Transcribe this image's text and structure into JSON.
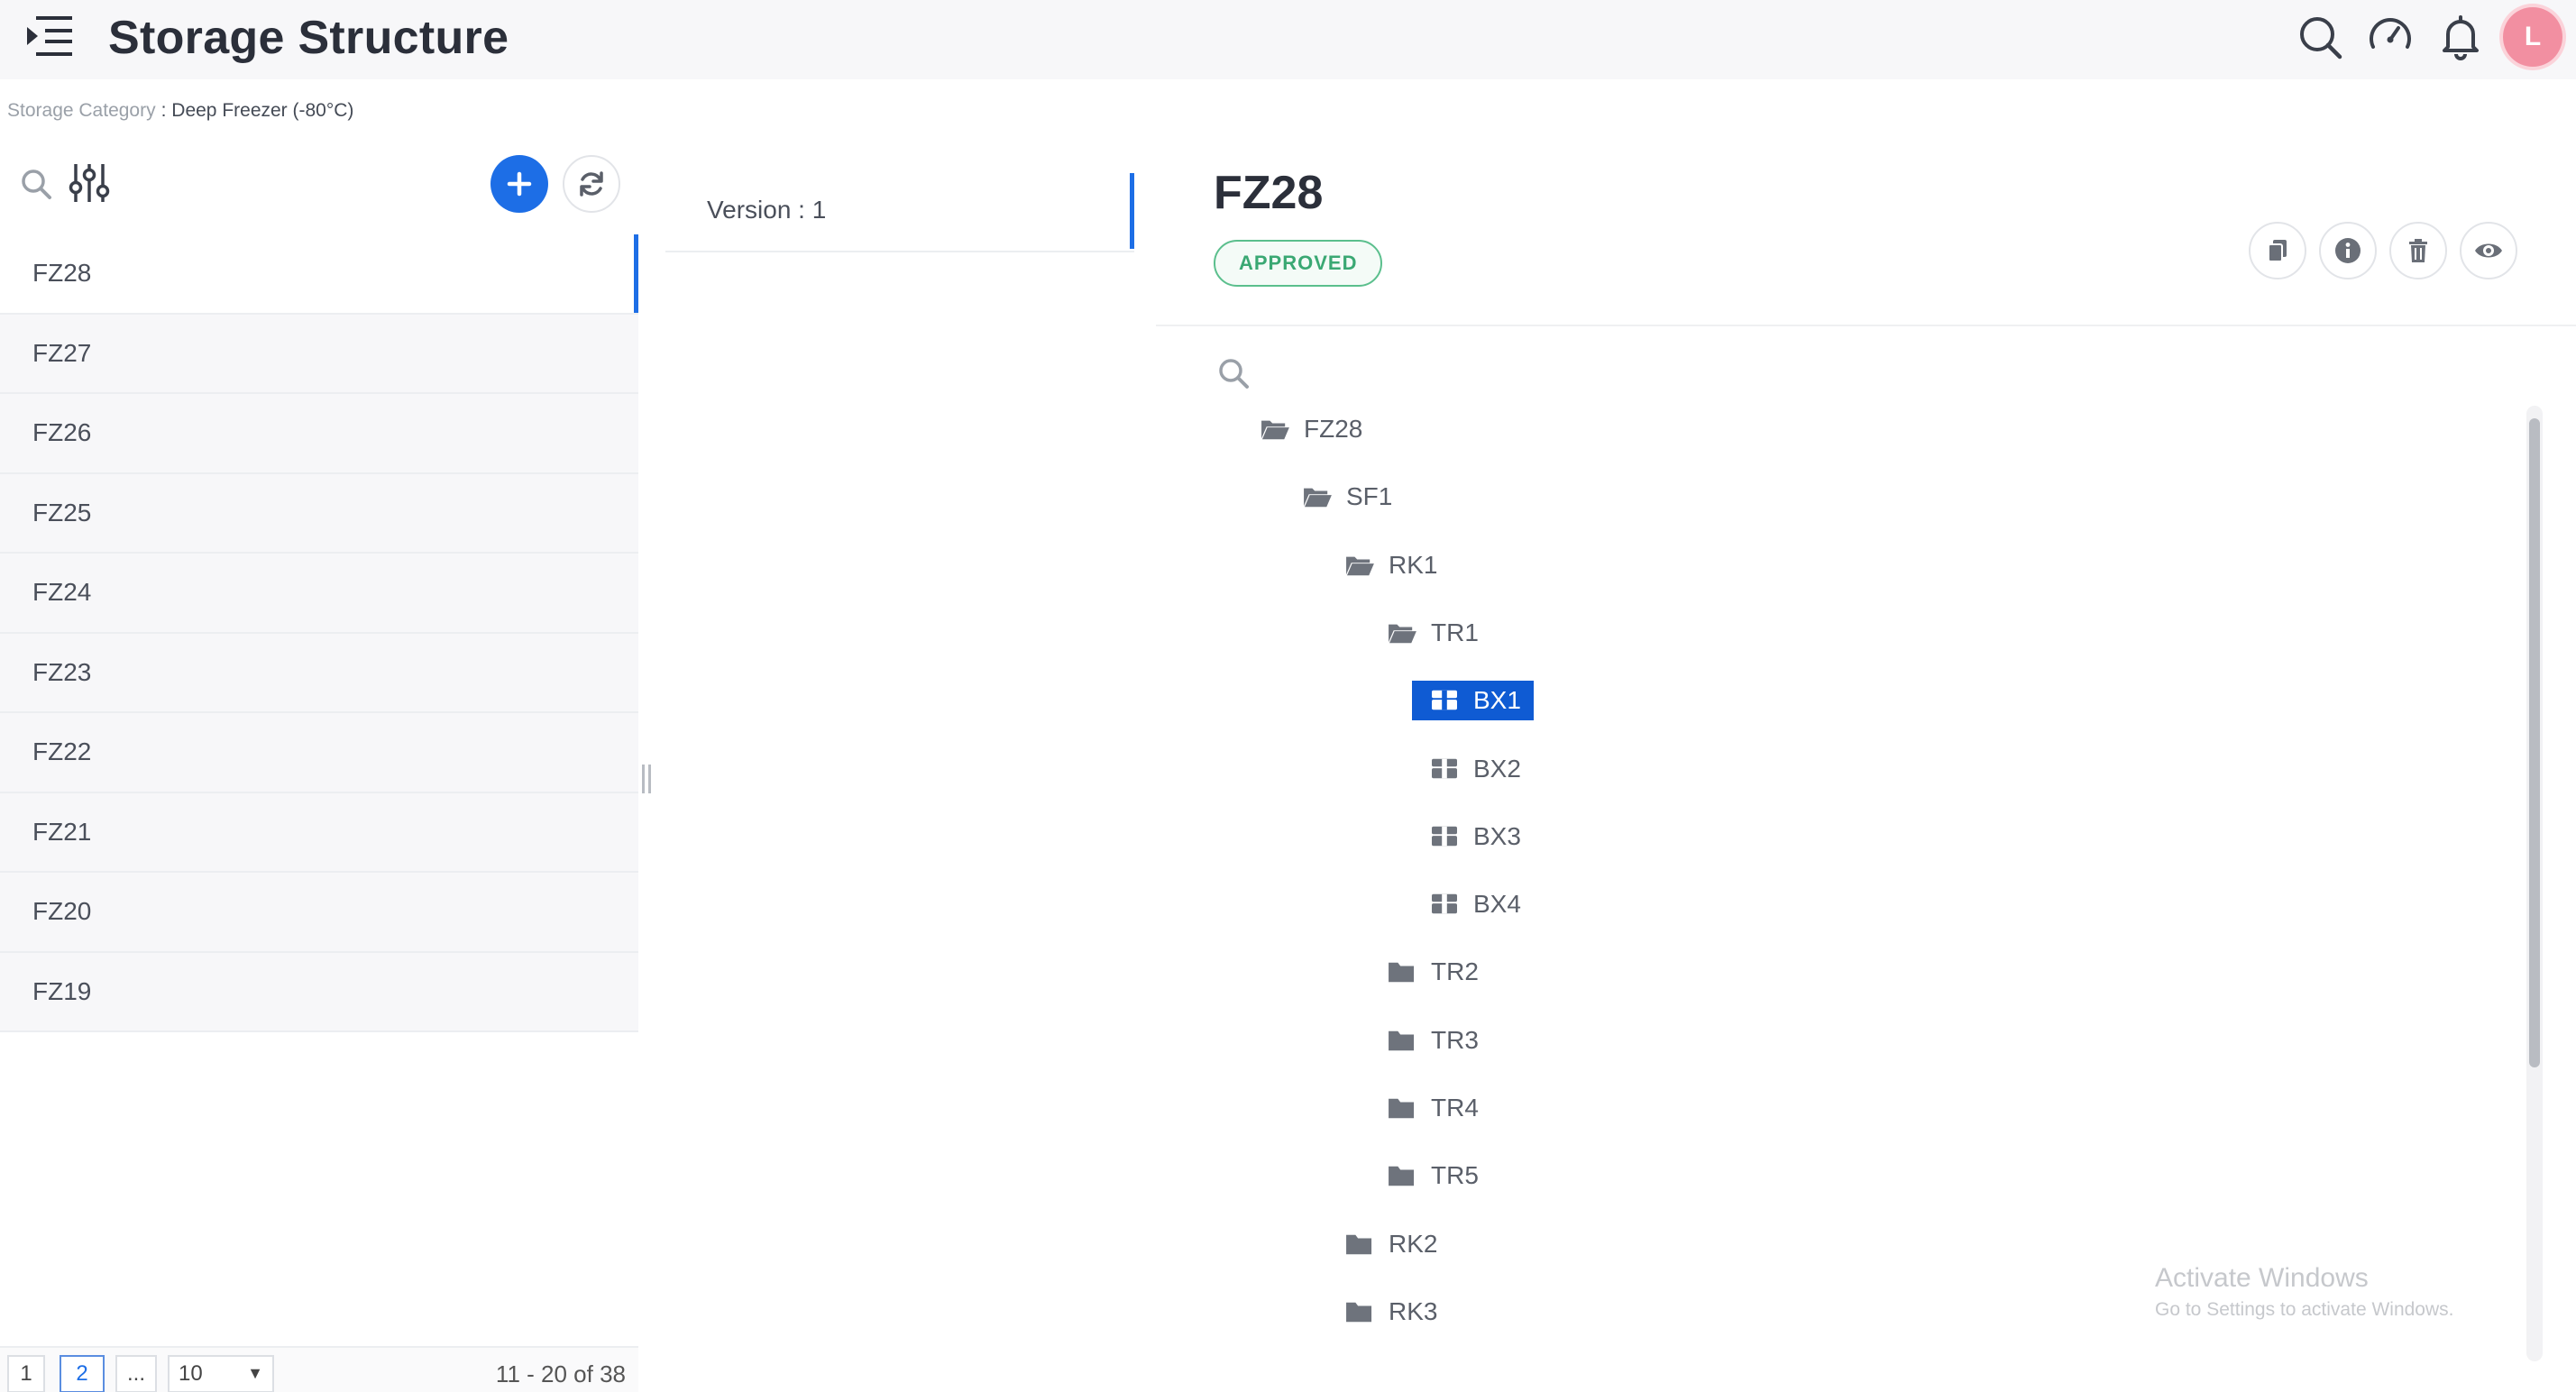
{
  "header": {
    "title": "Storage Structure",
    "avatar_initial": "L"
  },
  "breadcrumb": {
    "label": "Storage Category",
    "value": ": Deep Freezer (-80°C)"
  },
  "left_panel": {
    "items": [
      "FZ28",
      "FZ27",
      "FZ26",
      "FZ25",
      "FZ24",
      "FZ23",
      "FZ22",
      "FZ21",
      "FZ20",
      "FZ19"
    ],
    "selected_index": 0,
    "pagination": {
      "pages": [
        "1",
        "2",
        "..."
      ],
      "active_page": "2",
      "page_size": "10",
      "range_text": "11 - 20 of 38"
    }
  },
  "version_panel": {
    "label": "Version : 1"
  },
  "detail": {
    "title": "FZ28",
    "status": "APPROVED"
  },
  "tree": [
    {
      "label": "FZ28",
      "type": "folder-open",
      "depth": 0
    },
    {
      "label": "SF1",
      "type": "folder-open",
      "depth": 1
    },
    {
      "label": "RK1",
      "type": "folder-open",
      "depth": 2
    },
    {
      "label": "TR1",
      "type": "folder-open",
      "depth": 3
    },
    {
      "label": "BX1",
      "type": "box",
      "depth": 4,
      "selected": true
    },
    {
      "label": "BX2",
      "type": "box",
      "depth": 4
    },
    {
      "label": "BX3",
      "type": "box",
      "depth": 4
    },
    {
      "label": "BX4",
      "type": "box",
      "depth": 4
    },
    {
      "label": "TR2",
      "type": "folder",
      "depth": 3
    },
    {
      "label": "TR3",
      "type": "folder",
      "depth": 3
    },
    {
      "label": "TR4",
      "type": "folder",
      "depth": 3
    },
    {
      "label": "TR5",
      "type": "folder",
      "depth": 3
    },
    {
      "label": "RK2",
      "type": "folder",
      "depth": 2
    },
    {
      "label": "RK3",
      "type": "folder",
      "depth": 2
    }
  ],
  "watermark": {
    "title": "Activate Windows",
    "subtitle": "Go to Settings to activate Windows."
  },
  "colors": {
    "accent": "#1d6ee6",
    "selected_node": "#0f5bd3",
    "approved": "#3aa873",
    "avatar": "#f28fa1"
  }
}
